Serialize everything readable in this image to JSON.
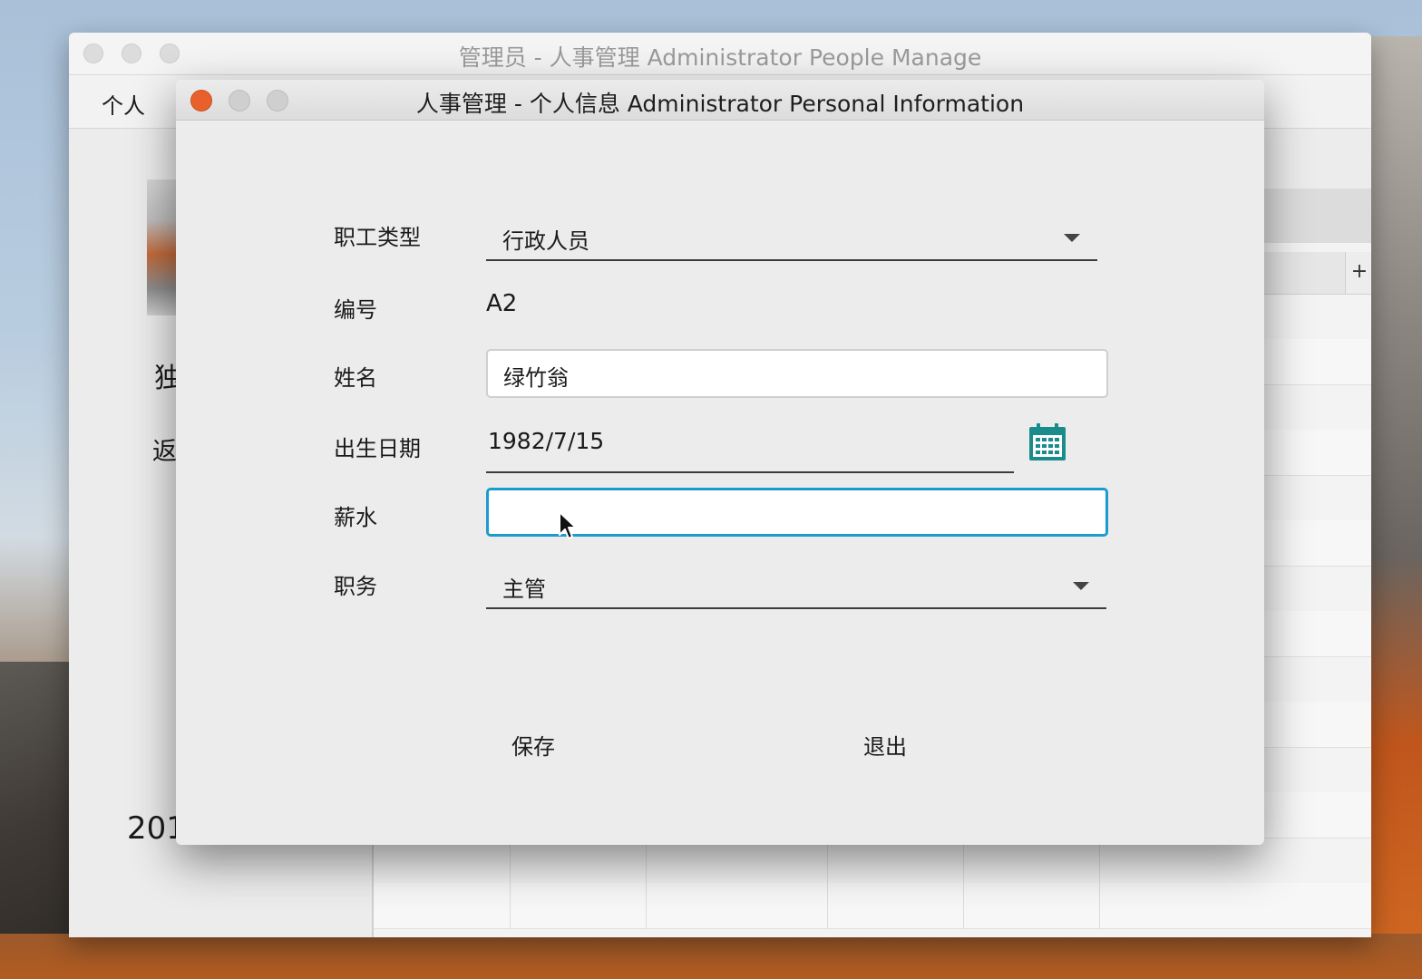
{
  "back_window": {
    "title": "管理员 - 人事管理 Administrator People Manage",
    "menu": {
      "personal": "个人"
    },
    "side_text_1": "独",
    "side_text_2": "返",
    "side_year": "201",
    "plus_label": "+"
  },
  "dialog": {
    "title": "人事管理 - 个人信息 Administrator Personal Information",
    "fields": {
      "employee_type": {
        "label": "职工类型",
        "value": "行政人员"
      },
      "id": {
        "label": "编号",
        "value": "A2"
      },
      "name": {
        "label": "姓名",
        "value": "绿竹翁"
      },
      "birth_date": {
        "label": "出生日期",
        "value": "1982/7/15"
      },
      "salary": {
        "label": "薪水",
        "value": ""
      },
      "position": {
        "label": "职务",
        "value": "主管"
      }
    },
    "buttons": {
      "save": "保存",
      "exit": "退出"
    },
    "icons": {
      "calendar": "calendar-icon",
      "dropdown": "chevron-down-icon"
    },
    "colors": {
      "close_button": "#e8612c",
      "focus_ring": "#1c9bd1",
      "calendar_icon": "#1b8c8c"
    }
  }
}
